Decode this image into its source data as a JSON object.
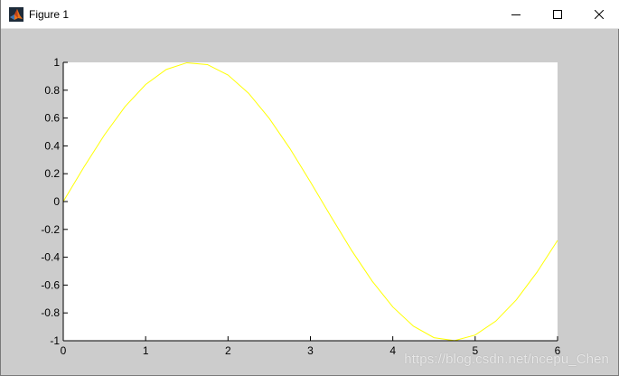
{
  "window": {
    "title": "Figure 1",
    "icon": "matlab-icon",
    "controls": [
      "minimize-icon",
      "maximize-icon",
      "close-icon"
    ]
  },
  "watermark": "https://blog.csdn.net/ncepu_Chen",
  "colors": {
    "figure_background": "#cccccc",
    "axes_background": "#ffffff",
    "line": "#ffff00"
  },
  "chart_data": {
    "type": "line",
    "function": "sin(x)",
    "title": "",
    "xlabel": "",
    "ylabel": "",
    "xlim": [
      0,
      6
    ],
    "ylim": [
      -1,
      1
    ],
    "xticks": [
      0,
      1,
      2,
      3,
      4,
      5,
      6
    ],
    "xtick_labels": [
      "0",
      "1",
      "2",
      "3",
      "4",
      "5",
      "6"
    ],
    "yticks": [
      -1,
      -0.8,
      -0.6,
      -0.4,
      -0.2,
      0,
      0.2,
      0.4,
      0.6,
      0.8,
      1
    ],
    "ytick_labels": [
      "-1",
      "-0.8",
      "-0.6",
      "-0.4",
      "-0.2",
      "0",
      "0.2",
      "0.4",
      "0.6",
      "0.8",
      "1"
    ],
    "grid": false,
    "series": [
      {
        "color": "#ffff00",
        "x": [
          0,
          0.25,
          0.5,
          0.75,
          1,
          1.25,
          1.5,
          1.75,
          2,
          2.25,
          2.5,
          2.75,
          3,
          3.25,
          3.5,
          3.75,
          4,
          4.25,
          4.5,
          4.75,
          5,
          5.25,
          5.5,
          5.75,
          6
        ],
        "y": [
          0,
          0.247,
          0.479,
          0.682,
          0.841,
          0.949,
          0.997,
          0.984,
          0.909,
          0.778,
          0.598,
          0.382,
          0.141,
          -0.108,
          -0.351,
          -0.572,
          -0.757,
          -0.895,
          -0.978,
          -0.999,
          -0.959,
          -0.859,
          -0.706,
          -0.508,
          -0.279
        ]
      }
    ]
  }
}
